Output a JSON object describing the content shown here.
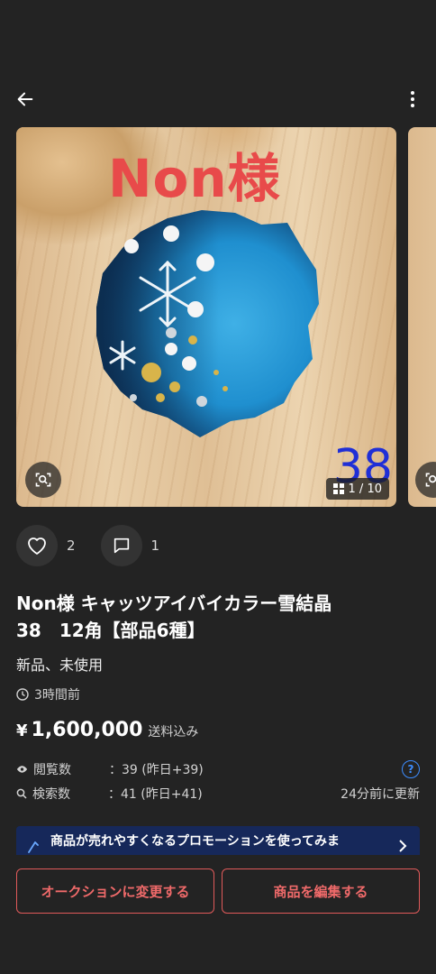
{
  "header": {
    "back_icon": "arrow-left-icon",
    "more_icon": "more-vertical-icon"
  },
  "gallery": {
    "watermark_text": "Non様",
    "photo_number": "38",
    "counter": "1 / 10",
    "counter_icon": "grid-icon",
    "scan_icon": "image-search-icon"
  },
  "actions": {
    "likes": "2",
    "comments": "1"
  },
  "item": {
    "title": "Non様 キャッツアイバイカラー雪結晶\n38　12角【部品6種】",
    "condition": "新品、未使用",
    "posted": "3時間前",
    "price_symbol": "¥",
    "price": "1,600,000",
    "shipping": "送料込み"
  },
  "stats": {
    "views_label": "閲覧数",
    "views_value": "：39 (昨日+39)",
    "searches_label": "検索数",
    "searches_value": "：41 (昨日+41)",
    "updated": "24分前に更新",
    "help": "?"
  },
  "promo": {
    "text": "商品が売れやすくなるプロモーションを使ってみま"
  },
  "buttons": {
    "auction": "オークションに変更する",
    "edit": "商品を編集する"
  },
  "colors": {
    "background": "#232323",
    "accent_red": "#e05a5a",
    "promo_bg": "#16285a",
    "help_blue": "#3d8dff"
  }
}
